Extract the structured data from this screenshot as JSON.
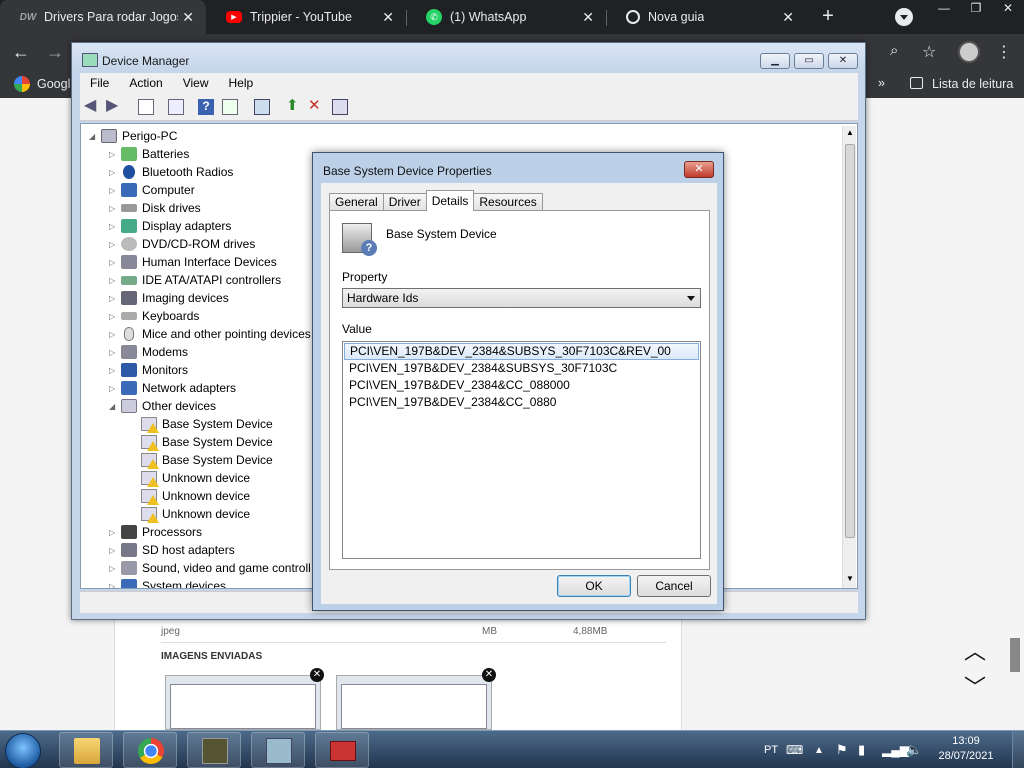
{
  "browser": {
    "tabs": [
      {
        "title": "Drivers Para rodar Jogos",
        "favicon": "dw-icon",
        "active": true
      },
      {
        "title": "Trippier - YouTube",
        "favicon": "youtube-icon",
        "active": false
      },
      {
        "title": "(1) WhatsApp",
        "favicon": "whatsapp-icon",
        "active": false
      },
      {
        "title": "Nova guia",
        "favicon": "globe-icon",
        "active": false
      }
    ],
    "bookmark_left": "Googl",
    "bookmark_right": "Lista de leitura"
  },
  "page": {
    "file_type": "jpeg",
    "file_unit": "MB",
    "file_size": "4,88MB",
    "sent_images_heading": "IMAGENS ENVIADAS"
  },
  "device_manager": {
    "title": "Device Manager",
    "menu": [
      "File",
      "Action",
      "View",
      "Help"
    ],
    "root": "Perigo-PC",
    "categories": [
      "Batteries",
      "Bluetooth Radios",
      "Computer",
      "Disk drives",
      "Display adapters",
      "DVD/CD-ROM drives",
      "Human Interface Devices",
      "IDE ATA/ATAPI controllers",
      "Imaging devices",
      "Keyboards",
      "Mice and other pointing devices",
      "Modems",
      "Monitors",
      "Network adapters",
      "Other devices"
    ],
    "other_devices": [
      "Base System Device",
      "Base System Device",
      "Base System Device",
      "Unknown device",
      "Unknown device",
      "Unknown device"
    ],
    "categories_after": [
      "Processors",
      "SD host adapters",
      "Sound, video and game controll",
      "System devices"
    ]
  },
  "dialog": {
    "title": "Base System Device Properties",
    "tabs": [
      "General",
      "Driver",
      "Details",
      "Resources"
    ],
    "active_tab": "Details",
    "device_name": "Base System Device",
    "property_label": "Property",
    "property_value": "Hardware Ids",
    "value_label": "Value",
    "values": [
      "PCI\\VEN_197B&DEV_2384&SUBSYS_30F7103C&REV_00",
      "PCI\\VEN_197B&DEV_2384&SUBSYS_30F7103C",
      "PCI\\VEN_197B&DEV_2384&CC_088000",
      "PCI\\VEN_197B&DEV_2384&CC_0880"
    ],
    "ok_label": "OK",
    "cancel_label": "Cancel"
  },
  "taskbar": {
    "language": "PT",
    "time": "13:09",
    "date": "28/07/2021"
  }
}
